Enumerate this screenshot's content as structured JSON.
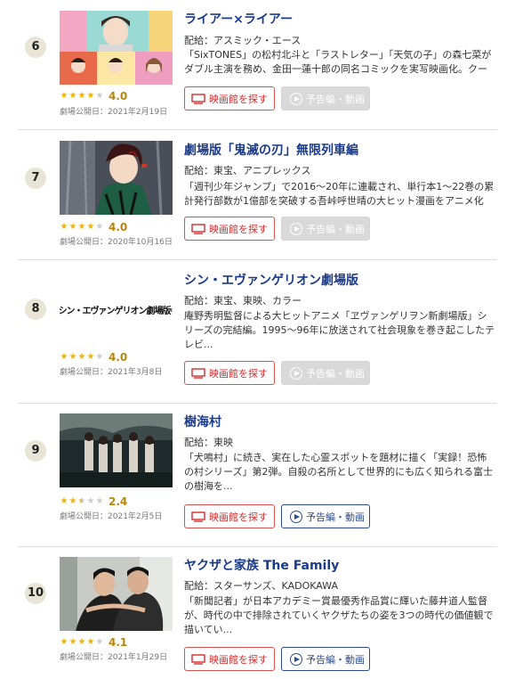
{
  "labels": {
    "distributor_prefix": "配給：",
    "release_prefix": "劇場公開日：",
    "theater_button": "映画館を探す",
    "trailer_button": "予告編・動画"
  },
  "colors": {
    "title": "#1a3a8a",
    "star": "#f0b400",
    "score": "#b8860b",
    "theater_button": "#d62b2b",
    "trailer_button_active": "#2b4a8f",
    "trailer_button_disabled": "#d9d9d9"
  },
  "movies": [
    {
      "rank": "6",
      "title": "ライアー×ライアー",
      "distributor": "アスミック・エース",
      "description": "「SixTONES」の松村北斗と「ラストレター」「天気の子」の森七菜がダブル主演を務め、金田一蓮十郎の同名コミックを実写映画化。クール...",
      "rating": 4.0,
      "score": "4.0",
      "release": "2021年2月19日",
      "trailer_available": false,
      "thumbnail": "poster-colorful-collage"
    },
    {
      "rank": "7",
      "title": "劇場版「鬼滅の刃」無限列車編",
      "distributor": "東宝、アニプレックス",
      "description": "「週刊少年ジャンプ」で2016〜20年に連載され、単行本1〜22巻の累計発行部数が1億部を突破する吾峠呼世晴の大ヒット漫画をアニメ化し...",
      "rating": 4.0,
      "score": "4.0",
      "release": "2020年10月16日",
      "trailer_available": false,
      "thumbnail": "anime-still-forest"
    },
    {
      "rank": "8",
      "title": "シン・エヴァンゲリオン劇場版",
      "distributor": "東宝、東映、カラー",
      "description": "庵野秀明監督による大ヒットアニメ「ヱヴァンゲリヲン新劇場版」シリーズの完結編。1995〜96年に放送されて社会現象を巻き起こしたテレビ...",
      "rating": 4.0,
      "score": "4.0",
      "release": "2021年3月8日",
      "trailer_available": false,
      "thumbnail": "title-logo",
      "logo_text": "シン・エヴァンゲリオン劇場版𝄇"
    },
    {
      "rank": "9",
      "title": "樹海村",
      "distributor": "東映",
      "description": "「犬鳴村」に続き、実在した心霊スポットを題材に描く「実録！恐怖の村シリーズ」第2弾。自殺の名所として世界的にも広く知られる富士の樹海を...",
      "rating": 2.4,
      "score": "2.4",
      "release": "2021年2月5日",
      "trailer_available": true,
      "thumbnail": "group-in-dark-forest"
    },
    {
      "rank": "10",
      "title": "ヤクザと家族 The Family",
      "distributor": "スターサンズ、KADOKAWA",
      "description": "「新聞記者」が日本アカデミー賞最優秀作品賞に輝いた藤井道人監督が、時代の中で排除されていくヤクザたちの姿を3つの時代の価値観で描いてい...",
      "rating": 4.1,
      "score": "4.1",
      "release": "2021年1月29日",
      "trailer_available": true,
      "thumbnail": "two-men-embracing"
    }
  ]
}
